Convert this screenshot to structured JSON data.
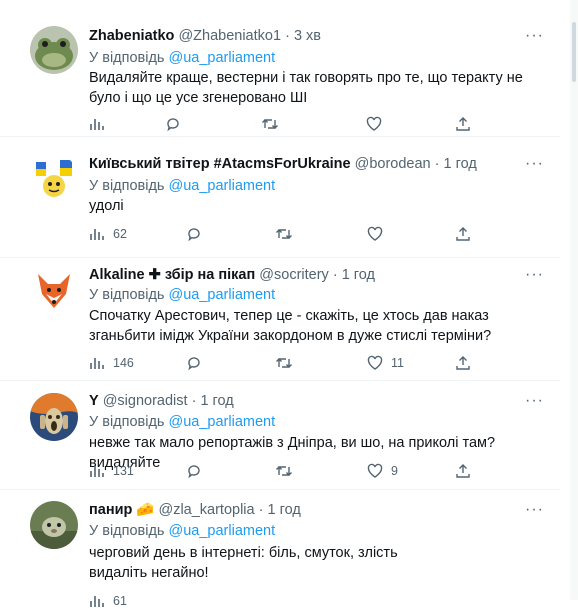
{
  "tweets": [
    {
      "name": "Zhabeniatko",
      "handle": "@Zhabeniatko1",
      "sep": "·",
      "time": "3 хв",
      "reply_prefix": "У відповідь",
      "reply_to": "@ua_parliament",
      "text": "Видаляйте краще, вестерни і так говорять про те, що теракту не було і що це усе згенеровано ШІ",
      "views": "",
      "replies": "",
      "retweets": "",
      "likes": "",
      "avatar_icon": "frog-avatar"
    },
    {
      "name": "Київський твітер #AtacmsForUkraine",
      "handle": "@borodean",
      "sep": "·",
      "time": "1 год",
      "reply_prefix": "У відповідь",
      "reply_to": "@ua_parliament",
      "text": "удолі",
      "views": "62",
      "replies": "",
      "retweets": "",
      "likes": "",
      "avatar_icon": "cartoon-flag-avatar"
    },
    {
      "name": "Alkaline ✚ збір на пікап",
      "handle": "@socritery",
      "sep": "·",
      "time": "1 год",
      "reply_prefix": "У відповідь",
      "reply_to": "@ua_parliament",
      "text": "Спочатку Арестович, тепер це - скажіть, це хтось дав наказ зганьбити імідж України закордоном в дуже стислі терміни?",
      "views": "146",
      "replies": "",
      "retweets": "",
      "likes": "11",
      "avatar_icon": "fox-avatar"
    },
    {
      "name": "Y",
      "handle": "@signoradist",
      "sep": "·",
      "time": "1 год",
      "reply_prefix": "У відповідь",
      "reply_to": "@ua_parliament",
      "text": "невже так мало репортажів з Дніпра, ви шо, на приколі там? видаляйте",
      "views": "131",
      "replies": "",
      "retweets": "",
      "likes": "9",
      "avatar_icon": "scream-painting-avatar"
    },
    {
      "name": "панир 🧀",
      "handle": "@zla_kartoplia",
      "sep": "·",
      "time": "1 год",
      "reply_prefix": "У відповідь",
      "reply_to": "@ua_parliament",
      "text": "черговий день в інтернеті: біль, смуток, злість видаліть негайно!",
      "views": "61",
      "replies": "",
      "retweets": "",
      "likes": "",
      "avatar_icon": "animal-photo-avatar"
    }
  ],
  "more_label": "···",
  "colors": {
    "text": "#0f1419",
    "muted": "#536471",
    "link": "#1d9bf0",
    "divider": "#eff3f4"
  }
}
